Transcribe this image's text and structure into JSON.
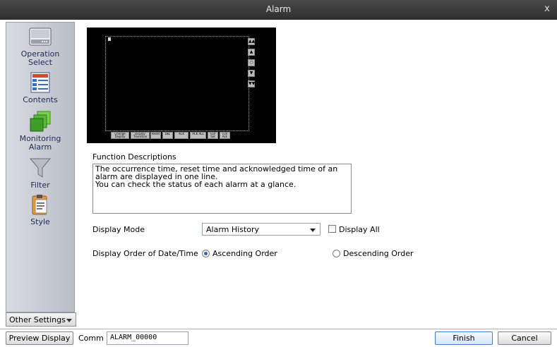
{
  "window": {
    "title": "Alarm",
    "close_glyph": "x"
  },
  "sidebar": {
    "items": [
      {
        "label": "Operation Select",
        "icon": "drive-icon"
      },
      {
        "label": "Contents",
        "icon": "document-icon"
      },
      {
        "label": "Monitoring Alarm",
        "icon": "stacked-squares-icon"
      },
      {
        "label": "Filter",
        "icon": "funnel-icon"
      },
      {
        "label": "Style",
        "icon": "clipboard-icon"
      }
    ],
    "other_settings_label": "Other Settings"
  },
  "preview": {
    "scroll_buttons": [
      "▲▲",
      "▲",
      "○",
      "▼",
      "▼▼"
    ],
    "bottom_buttons": [
      "Change Display",
      "Display Transition",
      "Reset",
      "DEL",
      "ACK",
      "ACK ALL",
      "Full Set",
      "Full Ack"
    ]
  },
  "main": {
    "function_descriptions_label": "Function Descriptions",
    "description_text": "The occurrence time, reset time and acknowledged time of an alarm are displayed in one line.\nYou can check the status of each alarm at a glance.",
    "display_mode_label": "Display Mode",
    "display_mode_value": "Alarm History",
    "display_all_label": "Display All",
    "display_all_checked": false,
    "display_order_label": "Display Order of Date/Time",
    "ascending_label": "Ascending Order",
    "descending_label": "Descending Order",
    "selected_order": "ascending"
  },
  "footer": {
    "preview_display_label": "Preview Display",
    "comm_label": "Comm",
    "comm_value": "ALARM_00000",
    "finish_label": "Finish",
    "cancel_label": "Cancel"
  },
  "colors": {
    "accent": "#2a62c8",
    "titlebar": "#3a3a3a",
    "sidebar": "#c9ccd3"
  }
}
